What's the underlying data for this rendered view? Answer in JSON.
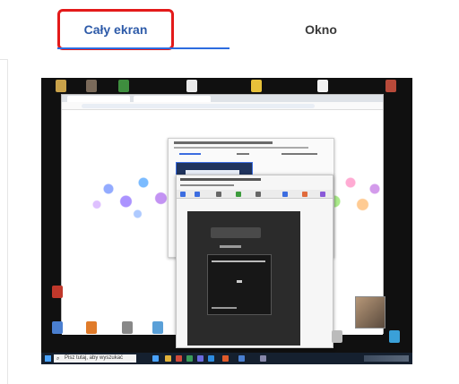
{
  "tabs": [
    {
      "label": "Cały ekran",
      "selected": true
    },
    {
      "label": "Okno",
      "selected": false
    }
  ],
  "preview": {
    "taskbar_search_placeholder": "Pisz tutaj, aby wyszukać"
  },
  "colors": {
    "active_tab_text": "#2d5aa8",
    "active_tab_underline": "#2d6cdf",
    "highlight_box": "#e31a1a",
    "preview_background": "#101010"
  }
}
